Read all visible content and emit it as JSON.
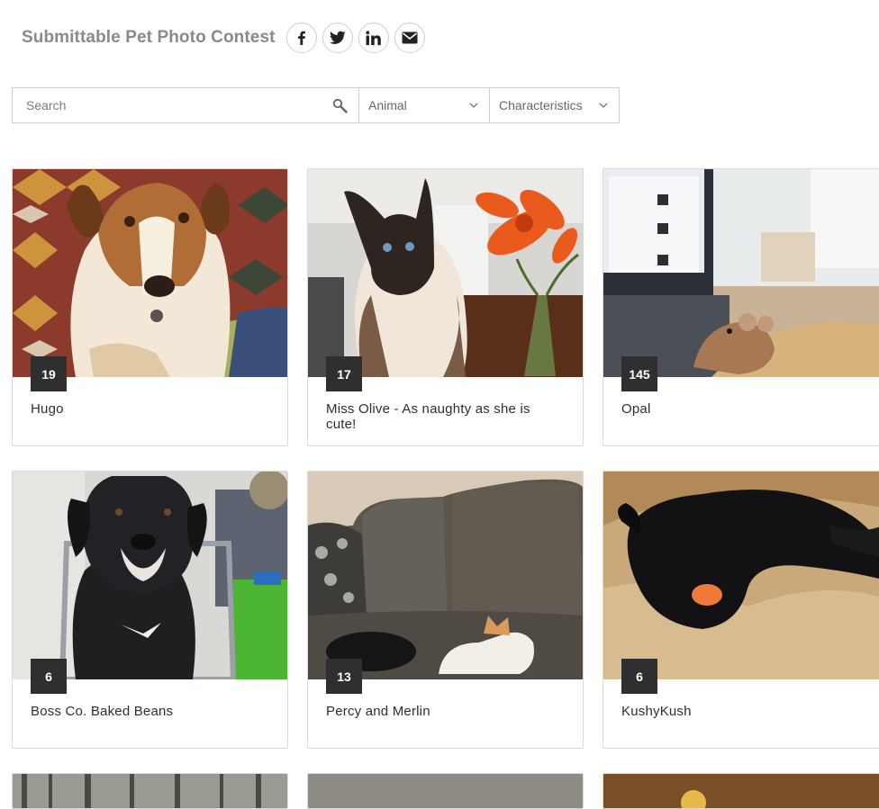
{
  "header": {
    "title": "Submittable Pet Photo Contest",
    "share_icons": [
      "facebook-icon",
      "twitter-icon",
      "linkedin-icon",
      "email-icon"
    ]
  },
  "filters": {
    "search_placeholder": "Search",
    "animal_label": "Animal",
    "characteristics_label": "Characteristics"
  },
  "entries": [
    {
      "votes": "19",
      "name": "Hugo"
    },
    {
      "votes": "17",
      "name": "Miss Olive - As naughty as she is cute!"
    },
    {
      "votes": "145",
      "name": "Opal"
    },
    {
      "votes": "6",
      "name": "Boss Co. Baked Beans"
    },
    {
      "votes": "13",
      "name": "Percy and Merlin"
    },
    {
      "votes": "6",
      "name": "KushyKush"
    }
  ],
  "colors": {
    "badge_bg": "#2f2f2f",
    "title": "#8a8a8a",
    "border": "#d9d9d9"
  }
}
